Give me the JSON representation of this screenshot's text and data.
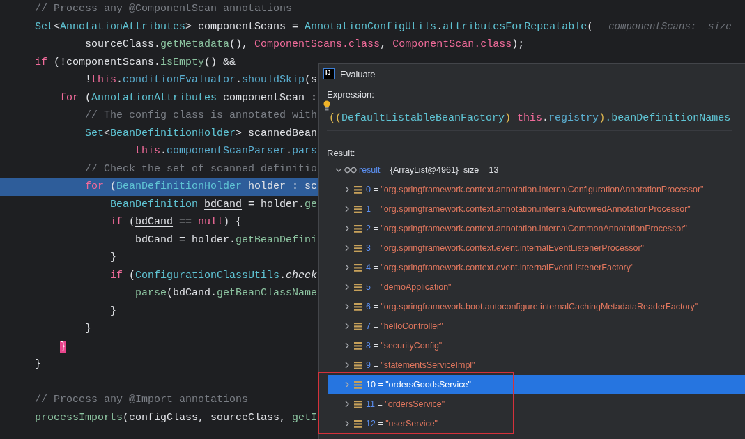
{
  "code": {
    "lines": [
      {
        "kind": "code",
        "tokens": [
          {
            "text": "// Process any @ComponentScan annotations",
            "kind": "comment"
          }
        ]
      },
      {
        "kind": "code",
        "tokens": [
          {
            "text": "Set",
            "kind": "type"
          },
          {
            "text": "<",
            "kind": "plain"
          },
          {
            "text": "AnnotationAttributes",
            "kind": "type"
          },
          {
            "text": "> componentScans = ",
            "kind": "plain"
          },
          {
            "text": "AnnotationConfigUtils",
            "kind": "type"
          },
          {
            "text": ".",
            "kind": "plain"
          },
          {
            "text": "attributesForRepeatable",
            "kind": "type"
          },
          {
            "text": "(",
            "kind": "plain"
          }
        ],
        "hint": "componentScans:  size",
        "children": [
          {
            "kind": "code",
            "continuation": true,
            "tokens": [
              {
                "text": "sourceClass.",
                "kind": "plain"
              },
              {
                "text": "getMetadata",
                "kind": "method"
              },
              {
                "text": "(), ",
                "kind": "plain"
              },
              {
                "text": "ComponentScans",
                "kind": "classref"
              },
              {
                "text": ".class",
                "kind": "keyword"
              },
              {
                "text": ", ",
                "kind": "plain"
              },
              {
                "text": "ComponentScan",
                "kind": "classref"
              },
              {
                "text": ".class",
                "kind": "keyword"
              },
              {
                "text": ");",
                "kind": "plain"
              }
            ]
          }
        ]
      },
      {
        "kind": "code",
        "tokens": [
          {
            "text": "if",
            "kind": "keyword"
          },
          {
            "text": " (!componentScans.",
            "kind": "plain"
          },
          {
            "text": "isEmpty",
            "kind": "method"
          },
          {
            "text": "() &&",
            "kind": "plain"
          }
        ],
        "children": [
          {
            "kind": "code",
            "continuation": true,
            "tokens": [
              {
                "text": "!",
                "kind": "plain"
              },
              {
                "text": "this",
                "kind": "keyword"
              },
              {
                "text": ".",
                "kind": "plain"
              },
              {
                "text": "conditionEvaluator",
                "kind": "field"
              },
              {
                "text": ".",
                "kind": "plain"
              },
              {
                "text": "shouldSkip",
                "kind": "field"
              },
              {
                "text": "(s",
                "kind": "plain"
              }
            ]
          },
          {
            "kind": "code",
            "tokens": [
              {
                "text": "for",
                "kind": "keyword"
              },
              {
                "text": " (",
                "kind": "plain"
              },
              {
                "text": "AnnotationAttributes",
                "kind": "type"
              },
              {
                "text": " componentScan :",
                "kind": "plain"
              }
            ],
            "children": [
              {
                "kind": "code",
                "tokens": [
                  {
                    "text": "// The config class is annotated with",
                    "kind": "comment"
                  }
                ]
              },
              {
                "kind": "code",
                "tokens": [
                  {
                    "text": "Set",
                    "kind": "type"
                  },
                  {
                    "text": "<",
                    "kind": "plain"
                  },
                  {
                    "text": "BeanDefinitionHolder",
                    "kind": "type"
                  },
                  {
                    "text": "> scannedBean",
                    "kind": "plain"
                  }
                ],
                "children": [
                  {
                    "kind": "code",
                    "continuation": true,
                    "tokens": [
                      {
                        "text": "this",
                        "kind": "keyword"
                      },
                      {
                        "text": ".",
                        "kind": "plain"
                      },
                      {
                        "text": "componentScanParser",
                        "kind": "field"
                      },
                      {
                        "text": ".",
                        "kind": "plain"
                      },
                      {
                        "text": "pars",
                        "kind": "field"
                      }
                    ]
                  }
                ]
              },
              {
                "kind": "code",
                "tokens": [
                  {
                    "text": "// Check the set of scanned definitio",
                    "kind": "comment"
                  }
                ]
              },
              {
                "kind": "code",
                "highlighted": true,
                "tokens": [
                  {
                    "text": "for",
                    "kind": "keyword"
                  },
                  {
                    "text": " (",
                    "kind": "plain"
                  },
                  {
                    "text": "BeanDefinitionHolder",
                    "kind": "type"
                  },
                  {
                    "text": " holder : sc",
                    "kind": "plain"
                  }
                ],
                "children": [
                  {
                    "kind": "code",
                    "tokens": [
                      {
                        "text": "BeanDefinition ",
                        "kind": "type"
                      },
                      {
                        "text": "bdCand",
                        "kind": "var"
                      },
                      {
                        "text": " = holder.",
                        "kind": "plain"
                      },
                      {
                        "text": "ge",
                        "kind": "method"
                      }
                    ]
                  },
                  {
                    "kind": "code",
                    "tokens": [
                      {
                        "text": "if",
                        "kind": "keyword"
                      },
                      {
                        "text": " (",
                        "kind": "plain"
                      },
                      {
                        "text": "bdCand",
                        "kind": "var"
                      },
                      {
                        "text": " == ",
                        "kind": "plain"
                      },
                      {
                        "text": "null",
                        "kind": "keyword"
                      },
                      {
                        "text": ") {",
                        "kind": "plain"
                      }
                    ],
                    "children": [
                      {
                        "kind": "code",
                        "tokens": [
                          {
                            "text": "bdCand",
                            "kind": "var"
                          },
                          {
                            "text": " = holder.",
                            "kind": "plain"
                          },
                          {
                            "text": "getBeanDefini",
                            "kind": "method"
                          }
                        ]
                      }
                    ]
                  },
                  {
                    "kind": "code",
                    "tokens": [
                      {
                        "text": "}",
                        "kind": "plain"
                      }
                    ]
                  },
                  {
                    "kind": "code",
                    "tokens": [
                      {
                        "text": "if",
                        "kind": "keyword"
                      },
                      {
                        "text": " (",
                        "kind": "plain"
                      },
                      {
                        "text": "ConfigurationClassUtils",
                        "kind": "type"
                      },
                      {
                        "text": ".",
                        "kind": "plain"
                      },
                      {
                        "text": "check",
                        "kind": "static"
                      }
                    ],
                    "children": [
                      {
                        "kind": "code",
                        "tokens": [
                          {
                            "text": "parse",
                            "kind": "method"
                          },
                          {
                            "text": "(",
                            "kind": "plain"
                          },
                          {
                            "text": "bdCand",
                            "kind": "var"
                          },
                          {
                            "text": ".",
                            "kind": "plain"
                          },
                          {
                            "text": "getBeanClassName",
                            "kind": "method"
                          }
                        ]
                      }
                    ]
                  },
                  {
                    "kind": "code",
                    "tokens": [
                      {
                        "text": "}",
                        "kind": "plain"
                      }
                    ]
                  }
                ]
              },
              {
                "kind": "code",
                "tokens": [
                  {
                    "text": "}",
                    "kind": "plain"
                  }
                ]
              }
            ]
          },
          {
            "kind": "code",
            "tokens": [
              {
                "text": "}",
                "kind": "brace"
              }
            ]
          }
        ]
      },
      {
        "kind": "code",
        "tokens": [
          {
            "text": "}",
            "kind": "plain"
          }
        ]
      },
      {
        "kind": "blank"
      },
      {
        "kind": "code",
        "tokens": [
          {
            "text": "// Process any @Import annotations",
            "kind": "comment"
          }
        ]
      },
      {
        "kind": "code",
        "tokens": [
          {
            "text": "processImports",
            "kind": "method"
          },
          {
            "text": "(configClass, sourceClass, ",
            "kind": "plain"
          },
          {
            "text": "getI",
            "kind": "method"
          }
        ]
      }
    ]
  },
  "evaluate_dialog": {
    "logo_text": "IJ",
    "title": "Evaluate",
    "expression_label": "Expression:",
    "expression": [
      {
        "text": "((",
        "kind": "paren"
      },
      {
        "text": "DefaultListableBeanFactory",
        "kind": "type"
      },
      {
        "text": ") ",
        "kind": "paren"
      },
      {
        "text": "this",
        "kind": "keyword"
      },
      {
        "text": ".",
        "kind": "plain"
      },
      {
        "text": "registry",
        "kind": "field"
      },
      {
        "text": ")",
        "kind": "paren"
      },
      {
        "text": ".beanDefinitionNames",
        "kind": "type"
      }
    ],
    "result_label": "Result:",
    "result": {
      "name": "result",
      "separator": "=",
      "value": "{ArrayList@4961}",
      "size": "size = 13",
      "expanded": true,
      "children": [
        {
          "index": "0",
          "separator": "=",
          "value": "\"org.springframework.context.annotation.internalConfigurationAnnotationProcessor\"",
          "expanded": false,
          "selected": false
        },
        {
          "index": "1",
          "separator": "=",
          "value": "\"org.springframework.context.annotation.internalAutowiredAnnotationProcessor\"",
          "expanded": false,
          "selected": false
        },
        {
          "index": "2",
          "separator": "=",
          "value": "\"org.springframework.context.annotation.internalCommonAnnotationProcessor\"",
          "expanded": false,
          "selected": false
        },
        {
          "index": "3",
          "separator": "=",
          "value": "\"org.springframework.context.event.internalEventListenerProcessor\"",
          "expanded": false,
          "selected": false
        },
        {
          "index": "4",
          "separator": "=",
          "value": "\"org.springframework.context.event.internalEventListenerFactory\"",
          "expanded": false,
          "selected": false
        },
        {
          "index": "5",
          "separator": "=",
          "value": "\"demoApplication\"",
          "expanded": false,
          "selected": false
        },
        {
          "index": "6",
          "separator": "=",
          "value": "\"org.springframework.boot.autoconfigure.internalCachingMetadataReaderFactory\"",
          "expanded": false,
          "selected": false
        },
        {
          "index": "7",
          "separator": "=",
          "value": "\"helloController\"",
          "expanded": false,
          "selected": false
        },
        {
          "index": "8",
          "separator": "=",
          "value": "\"securityConfig\"",
          "expanded": false,
          "selected": false
        },
        {
          "index": "9",
          "separator": "=",
          "value": "\"statementsServiceImpl\"",
          "expanded": false,
          "selected": false
        },
        {
          "index": "10",
          "separator": "=",
          "value": "\"ordersGoodsService\"",
          "expanded": false,
          "selected": true
        },
        {
          "index": "11",
          "separator": "=",
          "value": "\"ordersService\"",
          "expanded": false,
          "selected": false
        },
        {
          "index": "12",
          "separator": "=",
          "value": "\"userService\"",
          "expanded": false,
          "selected": false
        }
      ]
    }
  }
}
